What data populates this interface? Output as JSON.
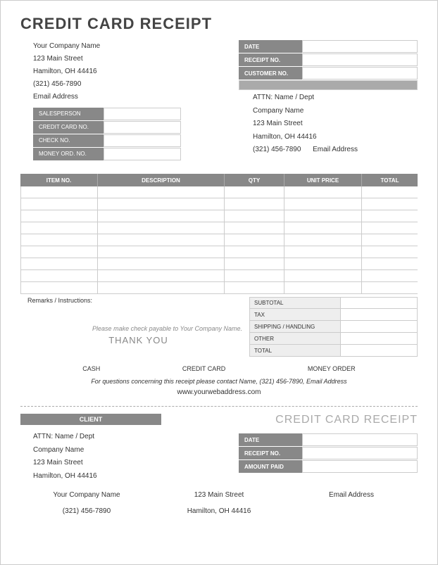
{
  "title": "CREDIT CARD RECEIPT",
  "company": {
    "name": "Your Company Name",
    "street": "123 Main Street",
    "city": "Hamilton, OH  44416",
    "phone": "(321) 456-7890",
    "email": "Email Address"
  },
  "meta": {
    "date_label": "DATE",
    "receipt_label": "RECEIPT NO.",
    "customer_label": "CUSTOMER NO."
  },
  "sales": {
    "salesperson": "SALESPERSON",
    "cc": "CREDIT CARD NO.",
    "check": "CHECK NO.",
    "money": "MONEY ORD. NO."
  },
  "attn": {
    "line1": "ATTN: Name / Dept",
    "line2": "Company Name",
    "line3": "123 Main Street",
    "line4": "Hamilton, OH  44416",
    "phone": "(321) 456-7890",
    "email": "Email Address"
  },
  "cols": {
    "item": "ITEM NO.",
    "desc": "DESCRIPTION",
    "qty": "QTY",
    "price": "UNIT PRICE",
    "total": "TOTAL"
  },
  "remarks_label": "Remarks / Instructions:",
  "totals": {
    "subtotal": "SUBTOTAL",
    "tax": "TAX",
    "ship": "SHIPPING / HANDLING",
    "other": "OTHER",
    "total": "TOTAL"
  },
  "payable": "Please make check payable to Your Company Name.",
  "thanks": "THANK YOU",
  "pay": {
    "cash": "CASH",
    "cc": "CREDIT CARD",
    "mo": "MONEY ORDER"
  },
  "questions": "For questions concerning this receipt please contact Name, (321) 456-7890, Email Address",
  "web": "www.yourwebaddress.com",
  "stub": {
    "client": "CLIENT",
    "title": "CREDIT CARD RECEIPT",
    "attn": "ATTN: Name / Dept",
    "company": "Company Name",
    "street": "123 Main Street",
    "city": "Hamilton, OH  44416",
    "date": "DATE",
    "receipt": "RECEIPT NO.",
    "amount": "AMOUNT PAID"
  },
  "footer": {
    "r1c1": "Your Company Name",
    "r1c2": "123 Main Street",
    "r1c3": "Email Address",
    "r2c1": "(321) 456-7890",
    "r2c2": "Hamilton, OH  44416"
  }
}
